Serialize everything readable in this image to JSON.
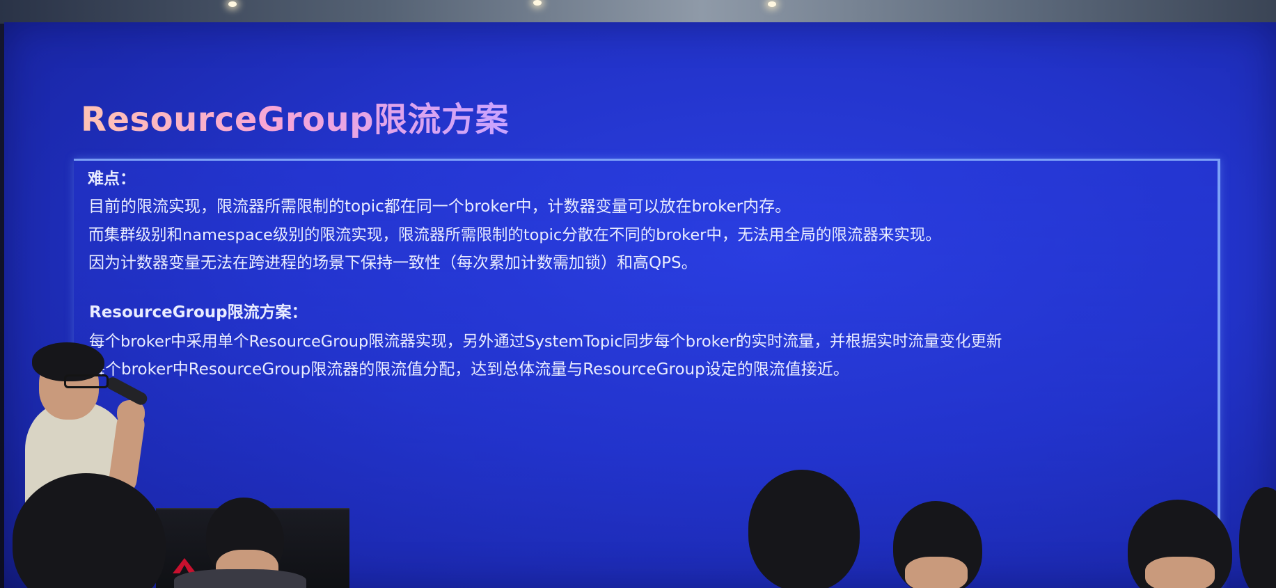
{
  "slide": {
    "title": "ResourceGroup限流方案",
    "section1": {
      "heading": "难点：",
      "lines": [
        "目前的限流实现，限流器所需限制的topic都在同一个broker中，计数器变量可以放在broker内存。",
        "而集群级别和namespace级别的限流实现，限流器所需限制的topic分散在不同的broker中，无法用全局的限流器来实现。",
        "因为计数器变量无法在跨进程的场景下保持一致性（每次累加计数需加锁）和高QPS。"
      ]
    },
    "section2": {
      "heading": "ResourceGroup限流方案：",
      "lines": [
        "每个broker中采用单个ResourceGroup限流器实现，另外通过SystemTopic同步每个broker的实时流量，并根据实时流量变化更新",
        "每个broker中ResourceGroup限流器的限流值分配，达到总体流量与ResourceGroup设定的限流值接近。"
      ]
    }
  },
  "colors": {
    "screen": "#2233c9",
    "title_gradient_start": "#ffc3b4",
    "title_gradient_end": "#c9a3ff",
    "body_text": "#e9ecff",
    "frame_border": "#8cb4ff"
  }
}
